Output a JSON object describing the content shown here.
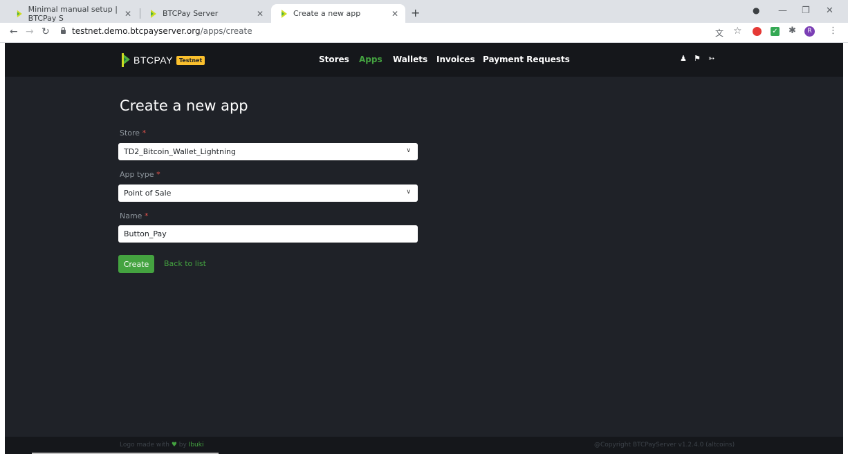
{
  "browser": {
    "tabs": [
      {
        "title": "Minimal manual setup | BTCPay S",
        "close": "✕"
      },
      {
        "title": "BTCPay Server",
        "close": "✕"
      },
      {
        "title": "Create a new app",
        "close": "✕"
      }
    ],
    "new_tab": "+",
    "url_host": "testnet.demo.btcpayserver.org",
    "url_path": "/apps/create",
    "extension_avatar": "R"
  },
  "app": {
    "brand": "BTCPAY",
    "badge": "Testnet",
    "nav": [
      "Stores",
      "Apps",
      "Wallets",
      "Invoices",
      "Payment Requests"
    ],
    "active_nav": "Apps",
    "accent": "#44a340"
  },
  "form": {
    "title": "Create a new app",
    "store_label": "Store",
    "store_value": "TD2_Bitcoin_Wallet_Lightning",
    "type_label": "App type",
    "type_value": "Point of Sale",
    "name_label": "Name",
    "name_value": "Button_Pay",
    "required_mark": "*",
    "create_button": "Create",
    "back_link": "Back to list"
  },
  "footer": {
    "left_prefix": "Logo made with",
    "left_by": "by",
    "left_name": "Ibuki",
    "right": "@Copyright BTCPayServer v1.2.4.0 (altcoins)"
  }
}
